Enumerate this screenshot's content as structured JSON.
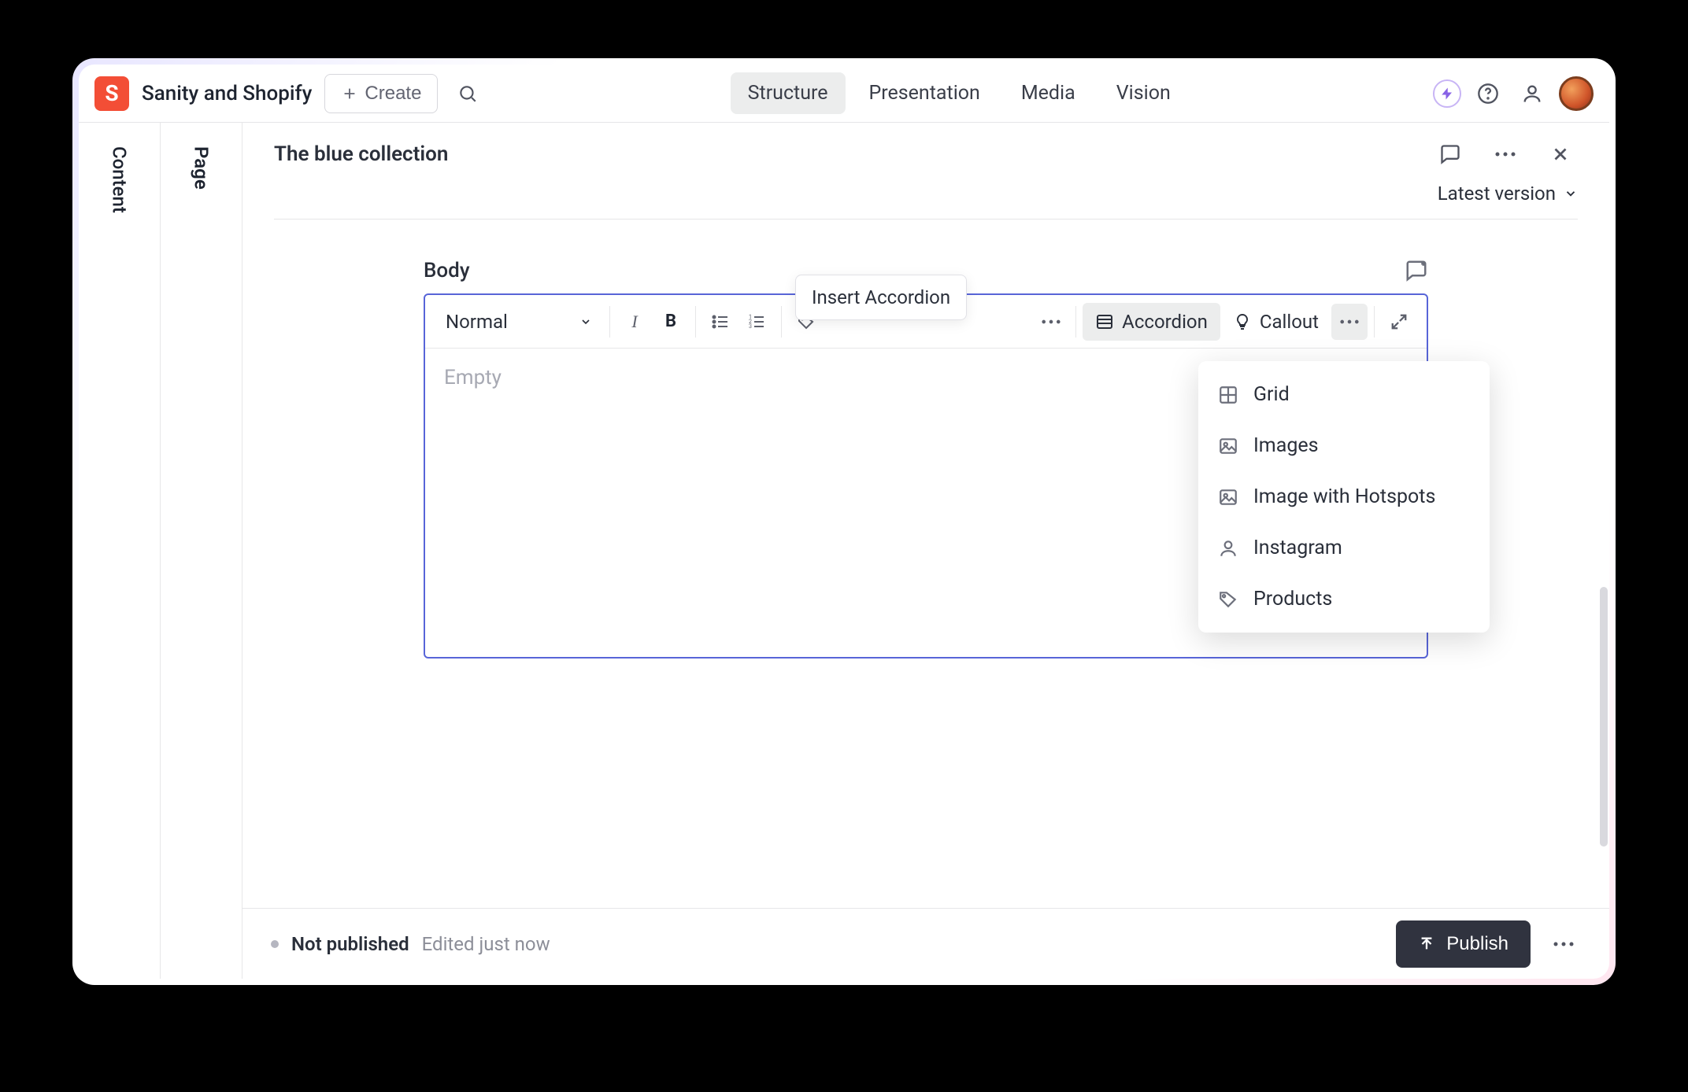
{
  "header": {
    "brand": "Sanity and Shopify",
    "create_label": "Create",
    "nav": [
      "Structure",
      "Presentation",
      "Media",
      "Vision"
    ],
    "active_nav_index": 0
  },
  "rails": {
    "first": "Content",
    "second": "Page"
  },
  "document": {
    "title": "The blue collection",
    "version_label": "Latest version"
  },
  "editor": {
    "field_label": "Body",
    "style_selected": "Normal",
    "placeholder": "Empty",
    "insert_buttons": [
      {
        "label": "Accordion",
        "icon": "rows-icon",
        "active": true
      },
      {
        "label": "Callout",
        "icon": "bulb-icon",
        "active": false
      }
    ],
    "tooltip_text": "Insert Accordion",
    "insert_menu": [
      {
        "label": "Grid",
        "icon": "grid-icon"
      },
      {
        "label": "Images",
        "icon": "image-icon"
      },
      {
        "label": "Image with Hotspots",
        "icon": "image-icon"
      },
      {
        "label": "Instagram",
        "icon": "user-icon"
      },
      {
        "label": "Products",
        "icon": "tag-icon"
      }
    ]
  },
  "footer": {
    "status": "Not published",
    "edited": "Edited just now",
    "publish_label": "Publish"
  }
}
